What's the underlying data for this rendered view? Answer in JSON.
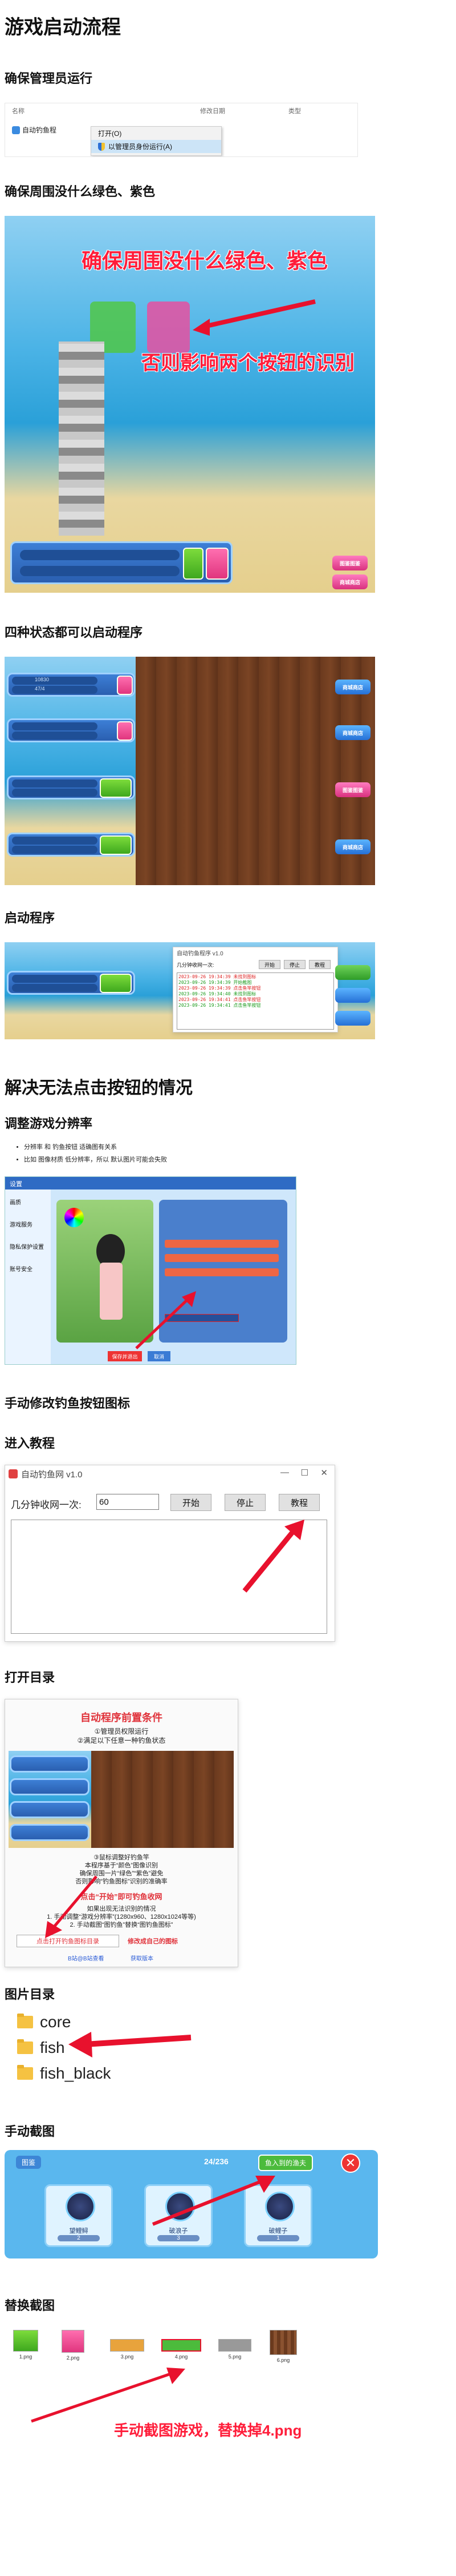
{
  "title": "游戏启动流程",
  "sec_admin": {
    "heading": "确保管理员运行",
    "cols": [
      "名称",
      "修改日期",
      "类型"
    ],
    "file_name": "自动钓鱼程",
    "menu_open": "打开(O)",
    "menu_admin": "以管理员身份运行(A)"
  },
  "sec_color": {
    "heading": "确保周围没什么绿色、紫色",
    "overlay_top": "确保周围没什么绿色、紫色",
    "overlay_bottom": "否则影响两个按钮的识别",
    "side_buttons": [
      "图鉴图鉴",
      "商城商店"
    ]
  },
  "sec_states": {
    "heading": "四种状态都可以启动程序",
    "stats": [
      "10830",
      "47/4"
    ],
    "side_buttons": [
      "商城商店",
      "商城商店",
      "图鉴图鉴",
      "商城商店"
    ]
  },
  "sec_start": {
    "heading": "启动程序",
    "app_title": "自动钓鱼程序 v1.0",
    "field_label": "几分钟收网一次:",
    "btn_start": "开始",
    "btn_stop": "停止",
    "btn_tutorial": "教程",
    "log": [
      "2023-09-26 19:34:39 未找到图标",
      "2023-09-26 19:34:39 开始截图",
      "2023-09-26 19:34:39 点击鱼竿按钮",
      "2023-09-26 19:34:40 未找到图标",
      "2023-09-26 19:34:41 点击鱼竿按钮",
      "2023-09-26 19:34:41 点击鱼竿按钮"
    ]
  },
  "sec_fix": {
    "heading": "解决无法点击按钮的情况",
    "sub_resolution": "调整游戏分辨率",
    "bullets": [
      "分辨率 和 钓鱼按钮 适确图有关系",
      "比如 图像材质 低分辨率，所以 默认图片可能会失败"
    ],
    "settings_title": "设置",
    "settings_tabs": [
      "画质",
      "游戏服务",
      "隐私保护设置",
      "账号安全"
    ],
    "settings_btn_ok": "保存并退出",
    "settings_btn_cancel": "取消"
  },
  "sec_icon": {
    "heading": "手动修改钓鱼按钮图标",
    "sub_tutorial": "进入教程",
    "app_title": "自动钓鱼网 v1.0",
    "field_label": "几分钟收网一次:",
    "field_value": "60",
    "btn_start": "开始",
    "btn_stop": "停止",
    "btn_tutorial": "教程",
    "sub_open_dir": "打开目录",
    "guide_title": "自动程序前置条件",
    "guide_lines": [
      "①管理员权限运行",
      "②满足以下任意一种钓鱼状态"
    ],
    "guide_notes": [
      "③鼠标调整好钓鱼竿",
      "本程序基于“颜色”图像识别",
      "确保周围一片“绿色”“紫色”避免",
      "否则影响“钓鱼图标”识别的准确率"
    ],
    "guide_red": "点击“开始”即可钓鱼收网",
    "guide_fix_title": "如果出现无法识别的情况",
    "guide_fix_lines": [
      "1. 手动调整“游戏分辨率”(1280x960、1280x1024等等)",
      "2. 手动截图“图钓鱼”替换“图钓鱼图标”"
    ],
    "guide_btn_open": "点击打开钓鱼图标目录",
    "guide_btn_modify": "修改成自己的图标",
    "guide_link_1": "B站@B站查看",
    "guide_link_2": "获取版本"
  },
  "sec_dir": {
    "heading": "图片目录",
    "folders": [
      "core",
      "fish",
      "fish_black"
    ]
  },
  "sec_shot": {
    "heading": "手动截图",
    "top_left": "图鉴",
    "counter": "24/236",
    "enter_label": "鱼入到的渔夫",
    "cards": [
      {
        "name": "望鲤鲟",
        "count": "2"
      },
      {
        "name": "破浪子",
        "count": "3"
      },
      {
        "name": "破鲤子",
        "count": "1"
      }
    ]
  },
  "sec_replace": {
    "heading": "替换截图",
    "files": [
      "1.png",
      "2.png",
      "3.png",
      "4.png",
      "5.png",
      "6.png"
    ],
    "caption": "手动截图游戏，替换掉4.png"
  }
}
